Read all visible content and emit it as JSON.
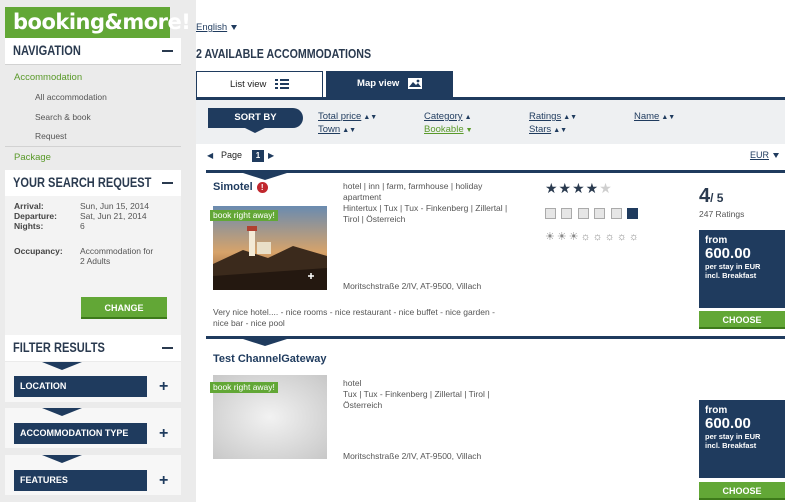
{
  "sidebar": {
    "logo": "booking&more!",
    "nav_title": "NAVIGATION",
    "nav": {
      "accommodation": "Accommodation",
      "all": "All accommodation",
      "search_book": "Search & book",
      "request": "Request",
      "package": "Package"
    },
    "search_title": "YOUR SEARCH REQUEST",
    "search": {
      "arrival_label": "Arrival:",
      "arrival_value": "Sun, Jun 15, 2014",
      "departure_label": "Departure:",
      "departure_value": "Sat, Jun 21, 2014",
      "nights_label": "Nights:",
      "nights_value": "6",
      "occupancy_label": "Occupancy:",
      "occupancy_line1": "Accommodation for",
      "occupancy_line2": "2 Adults",
      "change_label": "CHANGE"
    },
    "filter_title": "FILTER RESULTS",
    "filters": [
      "LOCATION",
      "ACCOMMODATION TYPE",
      "FEATURES"
    ]
  },
  "main": {
    "language": "English",
    "heading": "2 AVAILABLE ACCOMMODATIONS",
    "tabs": {
      "list": "List view",
      "map": "Map view"
    },
    "sort": {
      "label": "SORT BY",
      "total_price": "Total price",
      "category": "Category",
      "ratings": "Ratings",
      "name": "Name",
      "town": "Town",
      "bookable": "Bookable",
      "stars": "Stars"
    },
    "pager": {
      "label": "Page",
      "number": "1",
      "currency": "EUR"
    },
    "results": [
      {
        "name": "Simotel",
        "badge": "book right away!",
        "desc1": "hotel | inn | farm, farmhouse | holiday",
        "desc2": "apartment",
        "desc3": "Hintertux | Tux | Tux - Finkenberg | Zillertal |",
        "desc4": "Tirol | Österreich",
        "address": "Moritschstraße 2/IV, AT-9500, Villach",
        "note1": "Very nice hotel.... - nice rooms - nice restaurant - nice buffet - nice garden -",
        "note2": "nice bar - nice pool",
        "stars_on": "★★★★",
        "stars_off": "★",
        "suns": "☀☀☀☼☼☼☼☼",
        "rating_value": "4",
        "rating_max": "/ 5",
        "rating_count": "247 Ratings",
        "price_from": "from",
        "price": "600.00",
        "price_note1": "per stay in EUR",
        "price_note2": "incl. Breakfast",
        "choose": "CHOOSE"
      },
      {
        "name": "Test ChannelGateway",
        "badge": "book right away!",
        "desc1": "hotel",
        "desc2": "Tux | Tux - Finkenberg | Zillertal | Tirol |",
        "desc3": "Österreich",
        "address": "Moritschstraße 2/IV, AT-9500, Villach",
        "price_from": "from",
        "price": "600.00",
        "price_note1": "per stay in EUR",
        "price_note2": "incl. Breakfast",
        "choose": "CHOOSE"
      }
    ]
  },
  "colors": {
    "brand_green": "#62a736",
    "navy": "#1f3b5e",
    "sidebar_bg": "#ebebeb",
    "alert_red": "#c0272d"
  }
}
